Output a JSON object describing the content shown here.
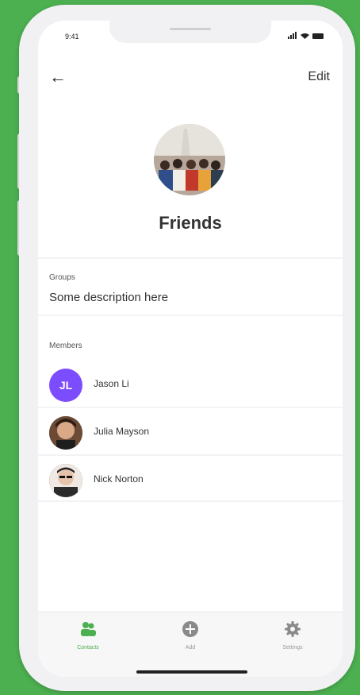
{
  "status": {
    "time": "9:41"
  },
  "topbar": {
    "back_label": "←",
    "edit_label": "Edit"
  },
  "group": {
    "title": "Friends"
  },
  "groups_section": {
    "label": "Groups",
    "description": "Some description here"
  },
  "members_section": {
    "label": "Members",
    "items": [
      {
        "name": "Jason Li",
        "initials": "JL"
      },
      {
        "name": "Julia Mayson"
      },
      {
        "name": "Nick Norton"
      }
    ]
  },
  "tabs": [
    {
      "label": "Contacts",
      "icon": "contacts-icon",
      "active": true
    },
    {
      "label": "Add",
      "icon": "add-icon",
      "active": false
    },
    {
      "label": "Settings",
      "icon": "gear-icon",
      "active": false
    }
  ],
  "colors": {
    "accent": "#4caf50",
    "avatar_purple": "#7c4dff",
    "background": "#4caf50"
  }
}
